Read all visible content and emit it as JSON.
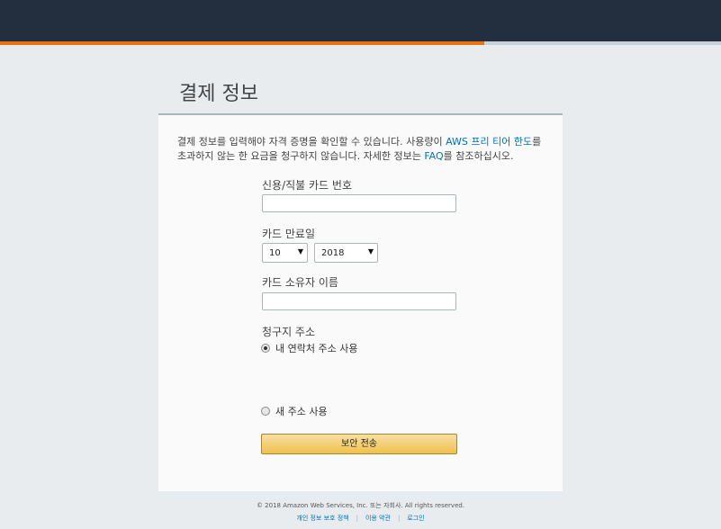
{
  "progress": {
    "fraction": 0.672
  },
  "page": {
    "title": "결제 정보"
  },
  "intro": {
    "text_before": "결제 정보를 입력해야 자격 증명을 확인할 수 있습니다. 사용량이 ",
    "free_tier_link": "AWS 프리 티어 한도",
    "text_middle": "를 초과하지 않는 한 요금을 청구하지 않습니다. 자세한 정보는 ",
    "faq_link": "FAQ",
    "text_after": "를 참조하십시오."
  },
  "form": {
    "card_number_label": "신용/직불 카드 번호",
    "card_number_value": "",
    "expiry_label": "카드 만료일",
    "expiry_month": "10",
    "expiry_year": "2018",
    "cardholder_label": "카드 소유자 이름",
    "cardholder_value": "",
    "billing_label": "청구지 주소",
    "option_contact": "내 연락처 주소 사용",
    "option_new": "새 주소 사용",
    "selected_option": "option_contact",
    "submit_label": "보안 전송"
  },
  "footer": {
    "copyright": "© 2018 Amazon Web Services, Inc. 또는 자회사. All rights reserved.",
    "links": [
      "개인 정보 보호 정책",
      "이용 약관",
      "로그인"
    ]
  },
  "colors": {
    "topbar": "#232f3e",
    "progress": "#ec7211",
    "link": "#0073bb",
    "button": "#f0c14b"
  }
}
